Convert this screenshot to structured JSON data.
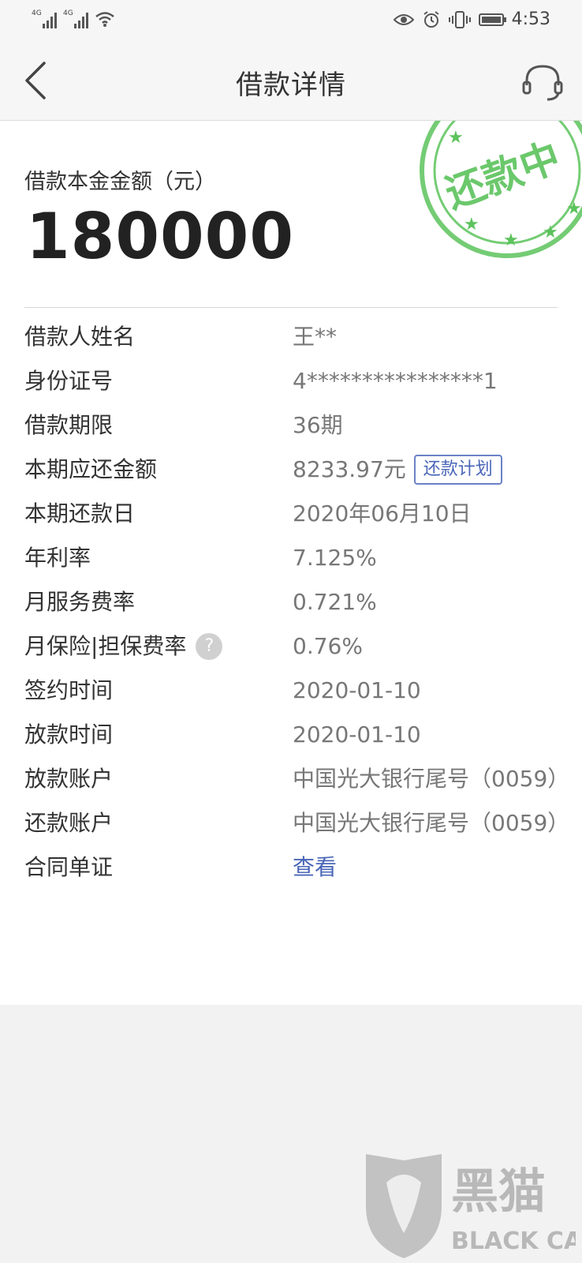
{
  "status_bar": {
    "signal_1": "4G",
    "signal_2": "4G",
    "time": "4:53",
    "icons": [
      "eye-icon",
      "alarm-icon",
      "vibrate-icon",
      "battery-icon",
      "wifi-icon"
    ]
  },
  "nav": {
    "title": "借款详情",
    "back_icon": "chevron-left-icon",
    "service_icon": "headset-icon"
  },
  "summary": {
    "amount_label": "借款本金金额（元）",
    "amount_value": "180000",
    "stamp_text": "还款中"
  },
  "details": {
    "borrower_name_label": "借款人姓名",
    "borrower_name_value": "王**",
    "id_label": "身份证号",
    "id_value": "4****************1",
    "term_label": "借款期限",
    "term_value": "36期",
    "due_amount_label": "本期应还金额",
    "due_amount_value": "8233.97元",
    "plan_button": "还款计划",
    "due_date_label": "本期还款日",
    "due_date_value": "2020年06月10日",
    "annual_rate_label": "年利率",
    "annual_rate_value": "7.125%",
    "service_fee_label": "月服务费率",
    "service_fee_value": "0.721%",
    "insurance_label": "月保险|担保费率",
    "help_glyph": "?",
    "insurance_value": "0.76%",
    "sign_time_label": "签约时间",
    "sign_time_value": "2020-01-10",
    "loan_time_label": "放款时间",
    "loan_time_value": "2020-01-10",
    "loan_account_label": "放款账户",
    "loan_account_value": "中国光大银行尾号（0059）",
    "repay_account_label": "还款账户",
    "repay_account_value": "中国光大银行尾号（0059）",
    "contract_label": "合同单证",
    "contract_link": "查看"
  },
  "watermark": {
    "cn": "黑猫",
    "en": "BLACK CAT"
  },
  "colors": {
    "accent_blue": "#4a66b8",
    "stamp_green": "#5cc35c",
    "background": "#f2f2f2",
    "card": "#ffffff"
  }
}
